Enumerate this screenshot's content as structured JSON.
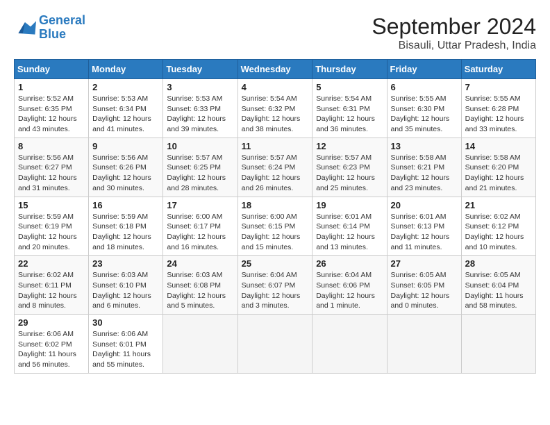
{
  "logo": {
    "line1": "General",
    "line2": "Blue"
  },
  "title": "September 2024",
  "subtitle": "Bisauli, Uttar Pradesh, India",
  "headers": [
    "Sunday",
    "Monday",
    "Tuesday",
    "Wednesday",
    "Thursday",
    "Friday",
    "Saturday"
  ],
  "weeks": [
    [
      {
        "day": "1",
        "sunrise": "5:52 AM",
        "sunset": "6:35 PM",
        "daylight": "12 hours and 43 minutes."
      },
      {
        "day": "2",
        "sunrise": "5:53 AM",
        "sunset": "6:34 PM",
        "daylight": "12 hours and 41 minutes."
      },
      {
        "day": "3",
        "sunrise": "5:53 AM",
        "sunset": "6:33 PM",
        "daylight": "12 hours and 39 minutes."
      },
      {
        "day": "4",
        "sunrise": "5:54 AM",
        "sunset": "6:32 PM",
        "daylight": "12 hours and 38 minutes."
      },
      {
        "day": "5",
        "sunrise": "5:54 AM",
        "sunset": "6:31 PM",
        "daylight": "12 hours and 36 minutes."
      },
      {
        "day": "6",
        "sunrise": "5:55 AM",
        "sunset": "6:30 PM",
        "daylight": "12 hours and 35 minutes."
      },
      {
        "day": "7",
        "sunrise": "5:55 AM",
        "sunset": "6:28 PM",
        "daylight": "12 hours and 33 minutes."
      }
    ],
    [
      {
        "day": "8",
        "sunrise": "5:56 AM",
        "sunset": "6:27 PM",
        "daylight": "12 hours and 31 minutes."
      },
      {
        "day": "9",
        "sunrise": "5:56 AM",
        "sunset": "6:26 PM",
        "daylight": "12 hours and 30 minutes."
      },
      {
        "day": "10",
        "sunrise": "5:57 AM",
        "sunset": "6:25 PM",
        "daylight": "12 hours and 28 minutes."
      },
      {
        "day": "11",
        "sunrise": "5:57 AM",
        "sunset": "6:24 PM",
        "daylight": "12 hours and 26 minutes."
      },
      {
        "day": "12",
        "sunrise": "5:57 AM",
        "sunset": "6:23 PM",
        "daylight": "12 hours and 25 minutes."
      },
      {
        "day": "13",
        "sunrise": "5:58 AM",
        "sunset": "6:21 PM",
        "daylight": "12 hours and 23 minutes."
      },
      {
        "day": "14",
        "sunrise": "5:58 AM",
        "sunset": "6:20 PM",
        "daylight": "12 hours and 21 minutes."
      }
    ],
    [
      {
        "day": "15",
        "sunrise": "5:59 AM",
        "sunset": "6:19 PM",
        "daylight": "12 hours and 20 minutes."
      },
      {
        "day": "16",
        "sunrise": "5:59 AM",
        "sunset": "6:18 PM",
        "daylight": "12 hours and 18 minutes."
      },
      {
        "day": "17",
        "sunrise": "6:00 AM",
        "sunset": "6:17 PM",
        "daylight": "12 hours and 16 minutes."
      },
      {
        "day": "18",
        "sunrise": "6:00 AM",
        "sunset": "6:15 PM",
        "daylight": "12 hours and 15 minutes."
      },
      {
        "day": "19",
        "sunrise": "6:01 AM",
        "sunset": "6:14 PM",
        "daylight": "12 hours and 13 minutes."
      },
      {
        "day": "20",
        "sunrise": "6:01 AM",
        "sunset": "6:13 PM",
        "daylight": "12 hours and 11 minutes."
      },
      {
        "day": "21",
        "sunrise": "6:02 AM",
        "sunset": "6:12 PM",
        "daylight": "12 hours and 10 minutes."
      }
    ],
    [
      {
        "day": "22",
        "sunrise": "6:02 AM",
        "sunset": "6:11 PM",
        "daylight": "12 hours and 8 minutes."
      },
      {
        "day": "23",
        "sunrise": "6:03 AM",
        "sunset": "6:10 PM",
        "daylight": "12 hours and 6 minutes."
      },
      {
        "day": "24",
        "sunrise": "6:03 AM",
        "sunset": "6:08 PM",
        "daylight": "12 hours and 5 minutes."
      },
      {
        "day": "25",
        "sunrise": "6:04 AM",
        "sunset": "6:07 PM",
        "daylight": "12 hours and 3 minutes."
      },
      {
        "day": "26",
        "sunrise": "6:04 AM",
        "sunset": "6:06 PM",
        "daylight": "12 hours and 1 minute."
      },
      {
        "day": "27",
        "sunrise": "6:05 AM",
        "sunset": "6:05 PM",
        "daylight": "12 hours and 0 minutes."
      },
      {
        "day": "28",
        "sunrise": "6:05 AM",
        "sunset": "6:04 PM",
        "daylight": "11 hours and 58 minutes."
      }
    ],
    [
      {
        "day": "29",
        "sunrise": "6:06 AM",
        "sunset": "6:02 PM",
        "daylight": "11 hours and 56 minutes."
      },
      {
        "day": "30",
        "sunrise": "6:06 AM",
        "sunset": "6:01 PM",
        "daylight": "11 hours and 55 minutes."
      },
      null,
      null,
      null,
      null,
      null
    ]
  ]
}
